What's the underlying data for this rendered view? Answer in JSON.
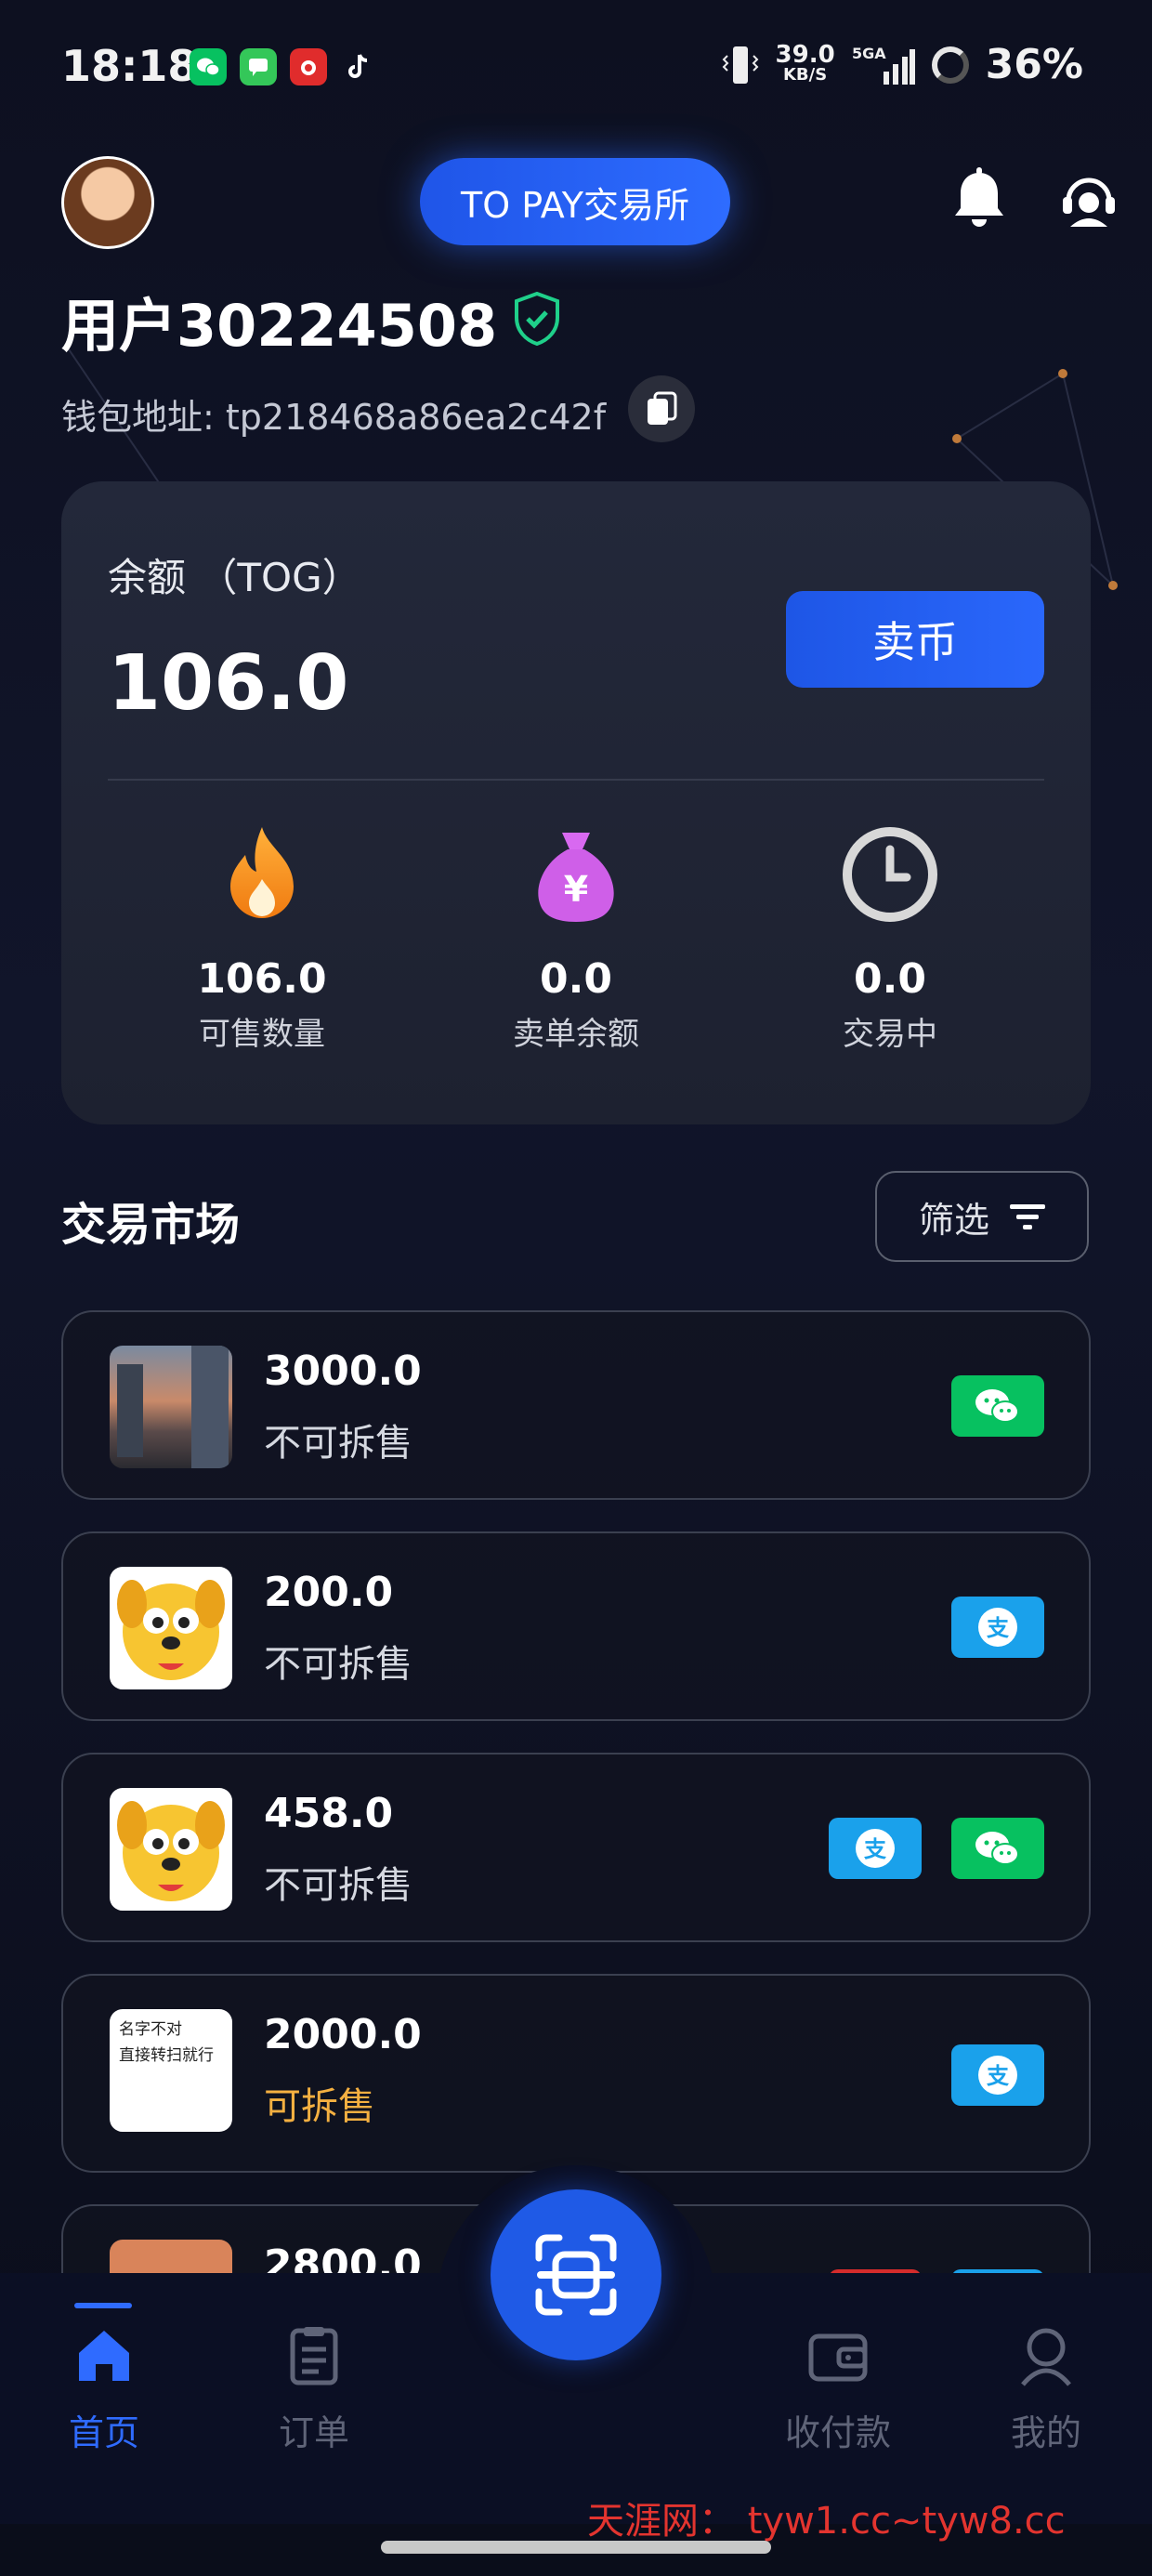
{
  "status_bar": {
    "time": "18:18",
    "net_speed": "39.0",
    "net_unit": "KB/S",
    "signal_label": "5G",
    "battery": "36%"
  },
  "header": {
    "exchange_label": "TO PAY交易所",
    "user_title": "用户30224508",
    "wallet_address": "钱包地址: tp218468a86ea2c42f"
  },
  "balance": {
    "label": "余额 （TOG）",
    "value": "106.0",
    "sell_label": "卖币",
    "stats": [
      {
        "icon": "fire-icon",
        "value": "106.0",
        "label": "可售数量"
      },
      {
        "icon": "money-bag-icon",
        "value": "0.0",
        "label": "卖单余额"
      },
      {
        "icon": "clock-icon",
        "value": "0.0",
        "label": "交易中"
      }
    ]
  },
  "market": {
    "title": "交易市场",
    "filter_label": "筛选",
    "listings": [
      {
        "amount": "3000.0",
        "split": "不可拆售",
        "payments": [
          "wechat"
        ]
      },
      {
        "amount": "200.0",
        "split": "不可拆售",
        "payments": [
          "alipay"
        ]
      },
      {
        "amount": "458.0",
        "split": "不可拆售",
        "payments": [
          "alipay",
          "wechat"
        ]
      },
      {
        "amount": "2000.0",
        "split": "可拆售",
        "payments": [
          "alipay"
        ],
        "thumb_text": [
          "名字不对",
          "直接转扫就行"
        ]
      },
      {
        "amount": "2800.0"
      }
    ]
  },
  "bottom_nav": {
    "items": [
      {
        "label": "首页",
        "active": true
      },
      {
        "label": "订单"
      },
      {
        "label": "收付款"
      },
      {
        "label": "我的"
      }
    ]
  },
  "watermark": "天涯网： tyw1.cc~tyw8.cc",
  "colors": {
    "accent": "#2f6bff",
    "wechat": "#07c160",
    "alipay": "#1aa1eb",
    "split_ok": "#f4b041"
  }
}
